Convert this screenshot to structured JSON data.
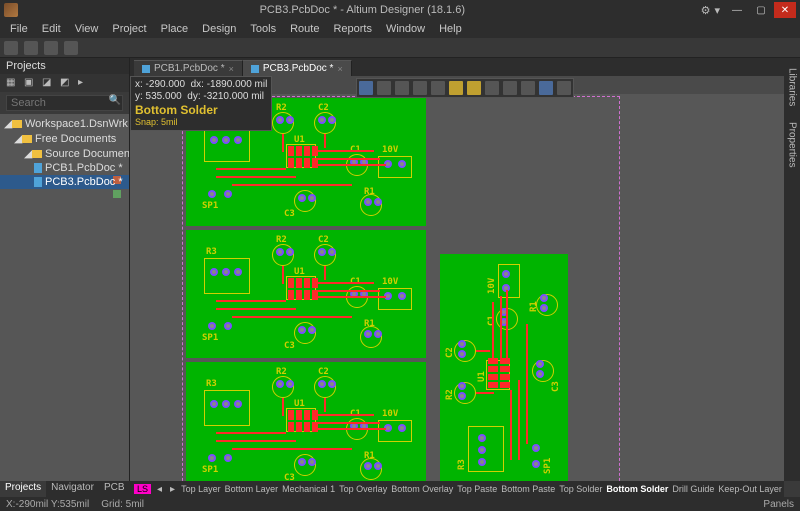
{
  "title": "PCB3.PcbDoc * - Altium Designer (18.1.6)",
  "menu": [
    "File",
    "Edit",
    "View",
    "Project",
    "Place",
    "Design",
    "Tools",
    "Route",
    "Reports",
    "Window",
    "Help"
  ],
  "projects_panel": {
    "title": "Projects",
    "search_placeholder": "Search"
  },
  "tree": {
    "workspace": "Workspace1.DsnWrk",
    "free_docs": "Free Documents",
    "source_docs": "Source Documents",
    "doc1": "PCB1.PcbDoc *",
    "doc2": "PCB3.PcbDoc *"
  },
  "doc_tabs": [
    {
      "label": "PCB1.PcbDoc *",
      "active": false
    },
    {
      "label": "PCB3.PcbDoc *",
      "active": true
    }
  ],
  "coord": {
    "x": "x: -290.000",
    "dx": "dx: -1890.000 mil",
    "y": "y:  535.000",
    "dy": "dy: -3210.000 mil",
    "layer": "Bottom Solder",
    "snap": "Snap: 5mil"
  },
  "pcb_refs": {
    "R1": "R1",
    "R2": "R2",
    "R3": "R3",
    "C1": "C1",
    "C2": "C2",
    "C3": "C3",
    "U1": "U1",
    "SP1": "SP1",
    "V10": "10V"
  },
  "side_tabs": [
    "Libraries",
    "Properties"
  ],
  "bottom_tabs": [
    "Projects",
    "Navigator",
    "PCB",
    "PCB Filter"
  ],
  "layer_strip": {
    "ls": "LS",
    "layers": [
      {
        "name": "Top Layer",
        "color": "#ff2a2a"
      },
      {
        "name": "Bottom Layer",
        "color": "#2a3aff"
      },
      {
        "name": "Mechanical 1",
        "color": "#00b400"
      },
      {
        "name": "Top Overlay",
        "color": "#d0d000"
      },
      {
        "name": "Bottom Overlay",
        "color": "#8a7a3a"
      },
      {
        "name": "Top Paste",
        "color": "#808080"
      },
      {
        "name": "Bottom Paste",
        "color": "#7a2a2a"
      },
      {
        "name": "Top Solder",
        "color": "#9a5aff"
      },
      {
        "name": "Bottom Solder",
        "color": "#c800c8"
      },
      {
        "name": "Drill Guide",
        "color": "#6a3a2a"
      },
      {
        "name": "Keep-Out Layer",
        "color": "#c800c8"
      }
    ],
    "active": "Bottom Solder"
  },
  "status": {
    "coords": "X:-290mil Y:535mil",
    "grid": "Grid: 5mil",
    "panels": "Panels"
  }
}
